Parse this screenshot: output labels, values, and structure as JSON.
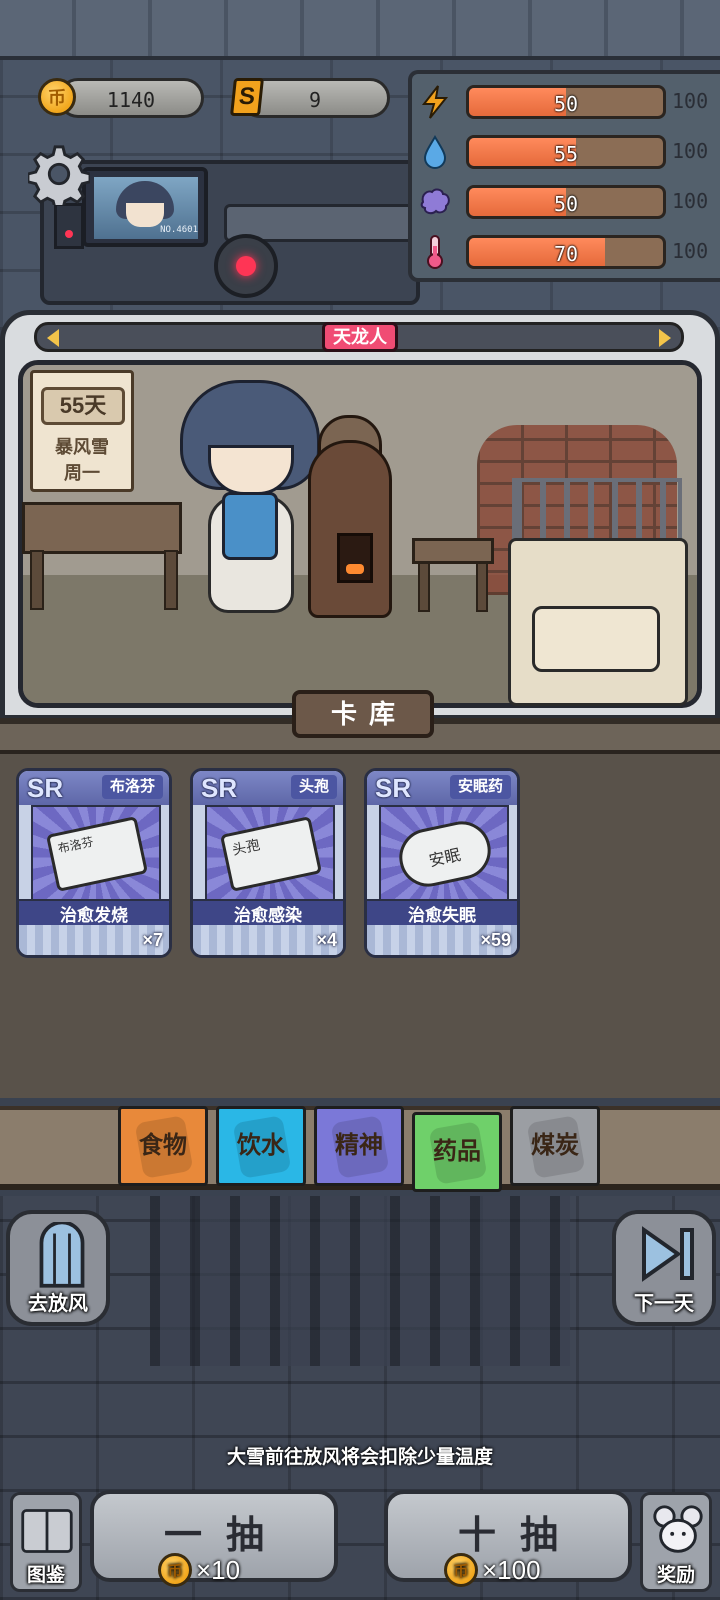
{
  "resources": {
    "coin_icon": "coin-icon",
    "coin_symbol": "币",
    "coins": "1140",
    "shard_icon": "s-ticket-icon",
    "shard_symbol": "S",
    "shards": "9"
  },
  "stats": [
    {
      "icon": "energy-icon",
      "value": 50,
      "max": "100",
      "color": "#f2a21d"
    },
    {
      "icon": "water-icon",
      "value": 55,
      "max": "100",
      "color": "#5aa9e6"
    },
    {
      "icon": "brain-icon",
      "value": 50,
      "max": "100",
      "color": "#8f7bd6"
    },
    {
      "icon": "thermometer-icon",
      "value": 70,
      "max": "100",
      "color": "#f05a8a"
    }
  ],
  "character": {
    "title": "天龙人",
    "monitor_id": "NO.4601"
  },
  "calendar": {
    "day": "55天",
    "weather": "暴风雪",
    "weekday": "周一"
  },
  "library": {
    "title": "卡库",
    "cards": [
      {
        "rarity": "SR",
        "name": "布洛芬",
        "art_label": "布洛芬",
        "effect": "治愈发烧",
        "count": "×7"
      },
      {
        "rarity": "SR",
        "name": "头孢",
        "art_label": "头孢",
        "effect": "治愈感染",
        "count": "×4"
      },
      {
        "rarity": "SR",
        "name": "安眠药",
        "art_label": "安眠",
        "effect": "治愈失眠",
        "count": "×59"
      }
    ]
  },
  "tabs": [
    {
      "label": "食物",
      "color": "#e8893a"
    },
    {
      "label": "饮水",
      "color": "#2ab7e6"
    },
    {
      "label": "精神",
      "color": "#7b78d8"
    },
    {
      "label": "药品",
      "color": "#6fd06a",
      "active": true
    },
    {
      "label": "煤炭",
      "color": "#9b9ea3"
    }
  ],
  "actions": {
    "go_out": "去放风",
    "next_day": "下一天",
    "hint": "大雪前往放风将会扣除少量温度",
    "single_draw": "一抽",
    "single_cost": "×10",
    "ten_draw": "十抽",
    "ten_cost": "×100",
    "codex": "图鉴",
    "reward": "奖励"
  },
  "colors": {
    "stat_fill": "#e56a3b",
    "title_tag": "#f04c74",
    "card_band": "#3e4687"
  }
}
